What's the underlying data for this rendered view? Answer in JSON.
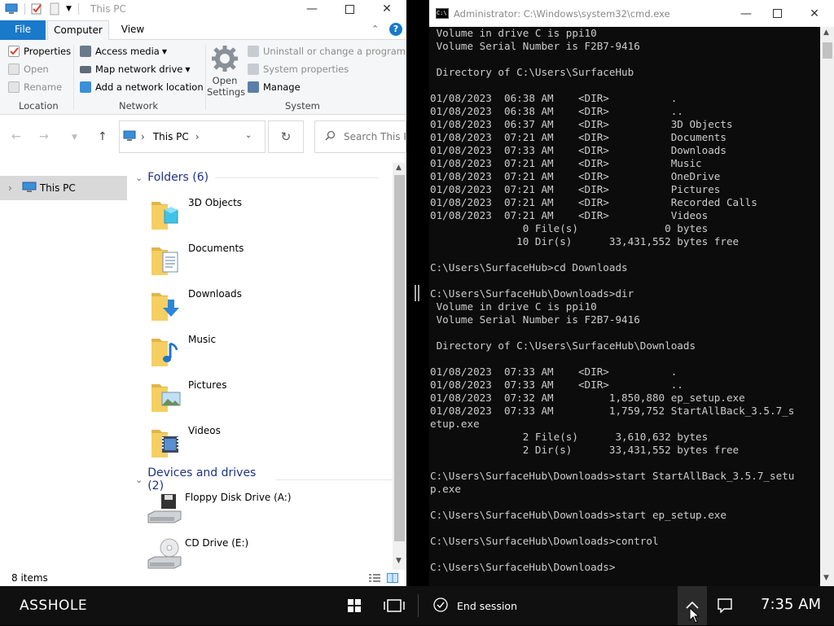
{
  "explorer": {
    "title": "This PC",
    "tabs": {
      "file": "File",
      "computer": "Computer",
      "view": "View"
    },
    "ribbon": {
      "location": {
        "properties": "Properties",
        "open": "Open",
        "rename": "Rename",
        "group_label": "Location"
      },
      "network": {
        "access_media": "Access media",
        "map_drive": "Map network drive",
        "add_location": "Add a network location",
        "group_label": "Network"
      },
      "system": {
        "open_settings_line1": "Open",
        "open_settings_line2": "Settings",
        "uninstall": "Uninstall or change a program",
        "system_properties": "System properties",
        "manage": "Manage",
        "group_label": "System"
      }
    },
    "address": {
      "location": "This PC",
      "search_placeholder": "Search This PC"
    },
    "nav": {
      "this_pc": "This PC"
    },
    "groups": {
      "folders": "Folders (6)",
      "devices": "Devices and drives (2)"
    },
    "folders": [
      "3D Objects",
      "Documents",
      "Downloads",
      "Music",
      "Pictures",
      "Videos"
    ],
    "drives": [
      "Floppy Disk Drive (A:)",
      "CD Drive (E:)"
    ],
    "status": "8 items"
  },
  "cmd": {
    "title": "Administrator: C:\\Windows\\system32\\cmd.exe",
    "lines": [
      " Volume in drive C is ppi10",
      " Volume Serial Number is F2B7-9416",
      "",
      " Directory of C:\\Users\\SurfaceHub",
      "",
      "01/08/2023  06:38 AM    <DIR>          .",
      "01/08/2023  06:38 AM    <DIR>          ..",
      "01/08/2023  06:37 AM    <DIR>          3D Objects",
      "01/08/2023  07:21 AM    <DIR>          Documents",
      "01/08/2023  07:33 AM    <DIR>          Downloads",
      "01/08/2023  07:21 AM    <DIR>          Music",
      "01/08/2023  07:21 AM    <DIR>          OneDrive",
      "01/08/2023  07:21 AM    <DIR>          Pictures",
      "01/08/2023  07:21 AM    <DIR>          Recorded Calls",
      "01/08/2023  07:21 AM    <DIR>          Videos",
      "               0 File(s)              0 bytes",
      "              10 Dir(s)      33,431,552 bytes free",
      "",
      "C:\\Users\\SurfaceHub>cd Downloads",
      "",
      "C:\\Users\\SurfaceHub\\Downloads>dir",
      " Volume in drive C is ppi10",
      " Volume Serial Number is F2B7-9416",
      "",
      " Directory of C:\\Users\\SurfaceHub\\Downloads",
      "",
      "01/08/2023  07:33 AM    <DIR>          .",
      "01/08/2023  07:33 AM    <DIR>          ..",
      "01/08/2023  07:32 AM         1,850,880 ep_setup.exe",
      "01/08/2023  07:33 AM         1,759,752 StartAllBack_3.5.7_s",
      "etup.exe",
      "               2 File(s)      3,610,632 bytes",
      "               2 Dir(s)      33,431,552 bytes free",
      "",
      "C:\\Users\\SurfaceHub\\Downloads>start StartAllBack_3.5.7_setu",
      "p.exe",
      "",
      "C:\\Users\\SurfaceHub\\Downloads>start ep_setup.exe",
      "",
      "C:\\Users\\SurfaceHub\\Downloads>control",
      "",
      "C:\\Users\\SurfaceHub\\Downloads>"
    ]
  },
  "taskbar": {
    "brand": "ASSHOLE",
    "end_session": "End session",
    "clock": "7:35 AM"
  },
  "colors": {
    "accent": "#1979ca",
    "folder": "#f5cf61",
    "cmd_text": "#cccccc"
  }
}
